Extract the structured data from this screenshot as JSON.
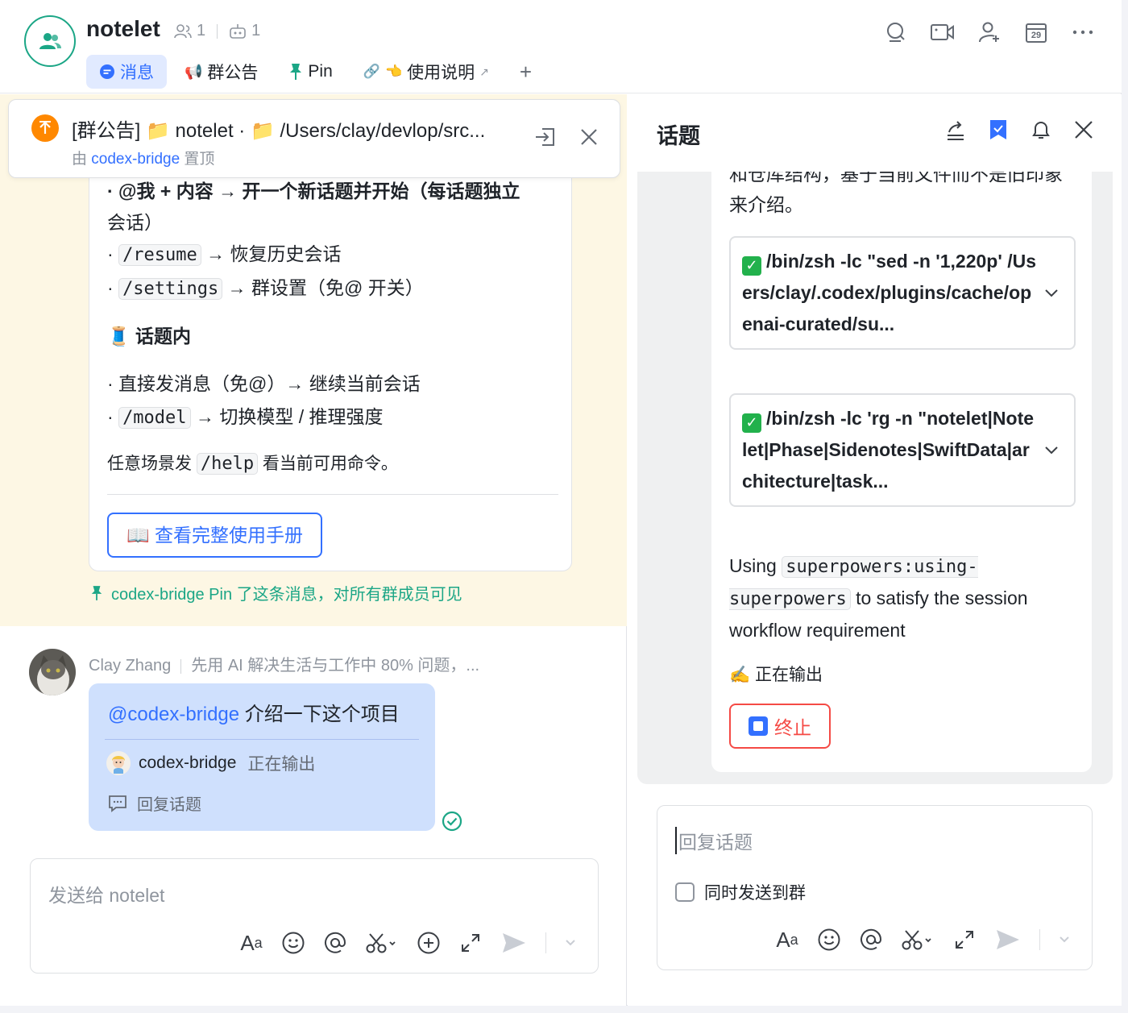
{
  "header": {
    "title": "notelet",
    "member_count": "1",
    "bot_count": "1",
    "tabs": [
      {
        "label": "消息",
        "active": true
      },
      {
        "label": "群公告"
      },
      {
        "label": "Pin"
      },
      {
        "label": "使用说明"
      }
    ],
    "calendar_day": "29",
    "accent_color": "#3370ff",
    "brand_green": "#1ba686"
  },
  "announcement": {
    "title": "[群公告] 📁 notelet · 📁 /Users/clay/devlop/src...",
    "by_prefix": "由",
    "by_name": "codex-bridge",
    "by_suffix": "置顶"
  },
  "pinned_card": {
    "line0": "· @我 + 内容 → 开一个新话题并开始（每话题独立",
    "line0b": "会话）",
    "line1_prefix": "·",
    "line1_code": "/resume",
    "line1_text": "→ 恢复历史会话",
    "line2_prefix": "·",
    "line2_code": "/settings",
    "line2_text": "→ 群设置（免@ 开关）",
    "section_title": "🧵 话题内",
    "line3": "· 直接发消息（免@）→ 继续当前会话",
    "line4_prefix": "·",
    "line4_code": "/model",
    "line4_text": "→ 切换模型 / 推理强度",
    "tip_prefix": "任意场景发",
    "tip_code": "/help",
    "tip_suffix": "看当前可用命令。",
    "manual_button": "📖 查看完整使用手册",
    "pin_note": "codex-bridge Pin 了这条消息，对所有群成员可见"
  },
  "message": {
    "sender": "Clay Zhang",
    "sender_signature": "先用 AI 解决生活与工作中 80% 问题，...",
    "mention": "@codex-bridge",
    "text": "介绍一下这个项目",
    "reply_bot": "codex-bridge",
    "reply_state": "正在输出",
    "reply_link": "回复话题"
  },
  "left_composer": {
    "placeholder": "发送给 notelet"
  },
  "thread": {
    "title": "话题",
    "clipped_text": "和仓库结构，基于当前文件而不是旧印象来介绍。",
    "cmd1": "/bin/zsh -lc \"sed -n '1,220p' /Users/clay/.codex/plugins/cache/openai-curated/su...",
    "cmd2": "/bin/zsh -lc 'rg -n \"notelet|Notelet|Phase|Sidenotes|SwiftData|architecture|task...",
    "using_prefix": "Using",
    "using_code": "superpowers:using-superpowers",
    "using_suffix": "to satisfy the session workflow requirement",
    "writing": "✍️ 正在输出",
    "stop_button": "终止",
    "stop_color": "#f54a45"
  },
  "right_composer": {
    "placeholder": "回复话题",
    "also_send_label": "同时发送到群"
  }
}
